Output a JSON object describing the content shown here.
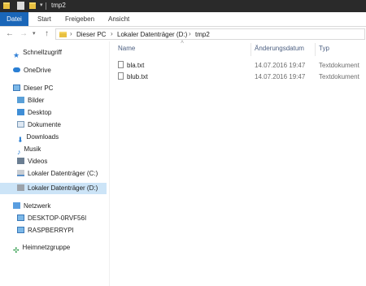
{
  "window": {
    "title": "tmp2"
  },
  "ribbon": {
    "tabs": [
      "Datei",
      "Start",
      "Freigeben",
      "Ansicht"
    ]
  },
  "address": {
    "segments": [
      "Dieser PC",
      "Lokaler Datenträger (D:)",
      "tmp2"
    ]
  },
  "sidebar": {
    "items": [
      {
        "label": "Schnellzugriff",
        "icon": "star-icon"
      },
      {
        "label": "OneDrive",
        "icon": "cloud-icon"
      },
      {
        "label": "Dieser PC",
        "icon": "computer-icon"
      },
      {
        "label": "Bilder",
        "icon": "pictures-icon"
      },
      {
        "label": "Desktop",
        "icon": "desktop-icon"
      },
      {
        "label": "Dokumente",
        "icon": "documents-icon"
      },
      {
        "label": "Downloads",
        "icon": "download-icon"
      },
      {
        "label": "Musik",
        "icon": "music-icon"
      },
      {
        "label": "Videos",
        "icon": "video-icon"
      },
      {
        "label": "Lokaler Datenträger (C:)",
        "icon": "drive-icon"
      },
      {
        "label": "Lokaler Datenträger (D:)",
        "icon": "drive-icon"
      },
      {
        "label": "Netzwerk",
        "icon": "network-icon"
      },
      {
        "label": "DESKTOP-0RVF56I",
        "icon": "computer-icon"
      },
      {
        "label": "RASPBERRYPI",
        "icon": "computer-icon"
      },
      {
        "label": "Heimnetzgruppe",
        "icon": "homegroup-icon"
      }
    ]
  },
  "columns": {
    "name": "Name",
    "date": "Änderungsdatum",
    "type": "Typ"
  },
  "files": [
    {
      "name": "bla.txt",
      "date": "14.07.2016 19:47",
      "type": "Textdokument"
    },
    {
      "name": "blub.txt",
      "date": "14.07.2016 19:47",
      "type": "Textdokument"
    }
  ],
  "colors": {
    "accent": "#1a66b8",
    "selection": "#cce4f7"
  }
}
